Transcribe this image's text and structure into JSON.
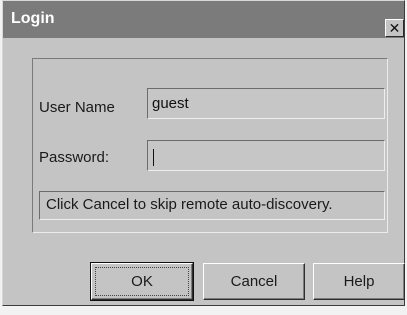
{
  "window": {
    "title": "Login",
    "close_glyph": "✕"
  },
  "form": {
    "username_label": "User Name",
    "username_value": "guest",
    "password_label": "Password:",
    "password_value": "",
    "info_text": "Click Cancel to skip remote auto-discovery."
  },
  "buttons": {
    "ok": "OK",
    "cancel": "Cancel",
    "help": "Help"
  },
  "colors": {
    "titlebar": "#7b7b7b",
    "dialog_bg": "#c4c4c4"
  }
}
